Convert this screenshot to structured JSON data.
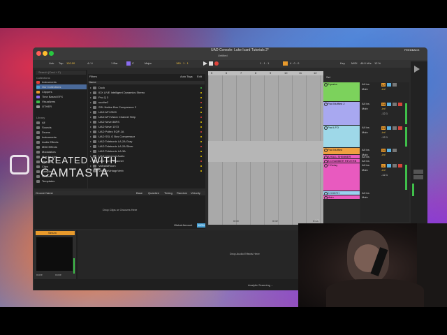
{
  "window": {
    "title": "UAD Console: Luke Icard Tutorials 2*",
    "subtitle": "Untitled"
  },
  "transport": {
    "link": "Link",
    "tap": "Tap",
    "tempo": "120.00",
    "timesig": "4 / 4",
    "bar": "1 Bar",
    "key": "C",
    "scale": "Major",
    "position": "180 . 1 . 1",
    "loop_pos": "1 . 1 . 1",
    "loop_len": "4 . 0 . 0",
    "key_label": "Key",
    "midi_label": "MIDI",
    "cpu": "46.0 kHz",
    "cpu_pct": "12 %",
    "feedback": "FEEDBACK"
  },
  "browser": {
    "search_placeholder": "Search (Cmd + F)",
    "collections_header": "Collections",
    "collections": [
      "Instruments",
      "Our Collections",
      "Clippers",
      "Time Based EFX",
      "Visualizers",
      "OTHER"
    ],
    "library_header": "Library",
    "library": [
      "All",
      "Sounds",
      "Drums",
      "Instruments",
      "Audio Effects",
      "MIDI Effects",
      "Modulators",
      "Max for Live",
      "Plug-ins",
      "Clips",
      "Samples",
      "Grooves",
      "Templates"
    ],
    "filters_label": "Filters",
    "auto_tags": "Auto Tags",
    "edit": "Edit",
    "name_header": "Name",
    "items": [
      "Duck",
      "IDX LIVE Intelligent Dynamics Stereo",
      "Pro-Q 3",
      "soothe2",
      "SSL Native Bus Compressor 2",
      "UAD API 2500",
      "UAD API Vision Channel Strip",
      "UAD Neve 88RS",
      "UAD Neve 1073",
      "UAD Pultec EQP-1A",
      "UAD SSL G Bus Compressor",
      "UAD Teletronix LA-2A Gray",
      "UAD Teletronix LA-2A Silver",
      "UAD Teletronix LA-3A",
      "UAD Universal Audio",
      "UAD Verve Channel",
      "ValhallaRoom",
      "ValhallaVintageVerb"
    ]
  },
  "groove": {
    "headers": [
      "Groove Name",
      "Base",
      "Quantize",
      "Timing",
      "Random",
      "Velocity"
    ],
    "drop_text": "Drop Clips or Grooves Here",
    "global_amount_label": "Global Amount",
    "global_amount": "100%",
    "pool_label": "Groove Pool"
  },
  "device": {
    "title": "Serum",
    "hint_left": "none",
    "hint_right": "none",
    "drop_text": "Drop Audio Effects Here"
  },
  "arrangement": {
    "set_label": "Set",
    "ruler": [
      "5",
      "6",
      "7",
      "8",
      "9",
      "10",
      "11",
      "12"
    ],
    "times": [
      "0:00",
      "0:02",
      "0:04"
    ],
    "page": "1/2"
  },
  "tracks": [
    {
      "name": "Equator",
      "color": "#7cd25c",
      "route": "All Ins",
      "num": "17"
    },
    {
      "name": "Pad Muffled 2",
      "color": "#a8a8f0",
      "route": "All Ins",
      "num": "18"
    },
    {
      "name": "Pad LFO",
      "color": "#9ed8e8",
      "route": "All Ins",
      "num": "19"
    },
    {
      "name": "Pad Muffled",
      "color": "#f0a040",
      "route": "All Ins",
      "num": "20"
    },
    {
      "name": "A HALL SHIMMER",
      "color": "#e85abf",
      "route": "All Ins",
      "num": "A"
    },
    {
      "name": "B CHAMBER REVERB",
      "color": "#e85abf",
      "route": "All Ins",
      "num": "B"
    },
    {
      "name": "C Delay",
      "color": "#e85abf",
      "route": "All Ins",
      "num": "C"
    },
    {
      "name": "D WIDTH",
      "color": "#9ad0f0",
      "route": "All Ins",
      "num": "D"
    },
    {
      "name": "Main",
      "color": "#e85abf",
      "route": "Main",
      "num": "M"
    }
  ],
  "mixer_labels": {
    "in": "In",
    "auto": "Auto",
    "off": "Off",
    "main": "Main",
    "vol": "-inf",
    "gain": "-12.1",
    "pan": "C"
  },
  "status": {
    "analyzing": "Analytic Scanning ..."
  },
  "watermark": {
    "line1": "CREATED WITH",
    "line2": "CAMTASTA"
  }
}
